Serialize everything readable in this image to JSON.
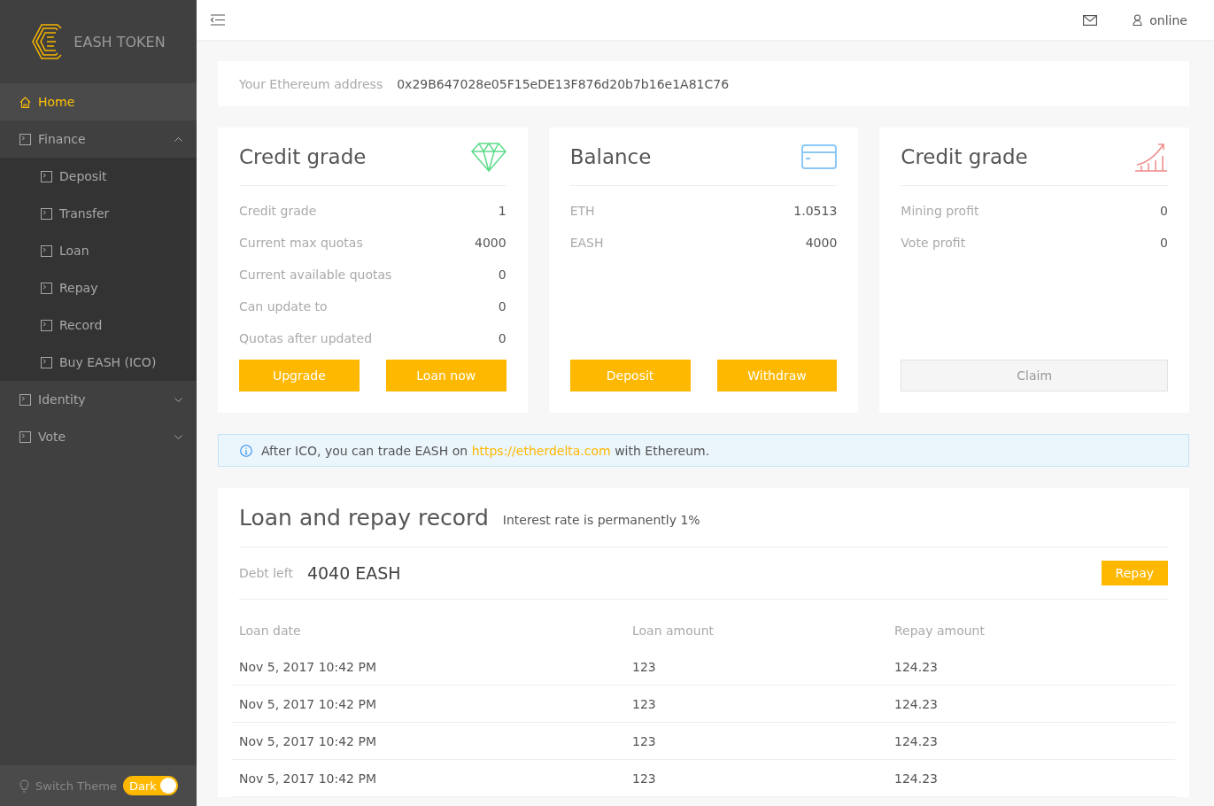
{
  "brand": {
    "name": "EASH TOKEN"
  },
  "sidebar": {
    "items": [
      {
        "label": "Home",
        "kind": "home",
        "selected": true
      },
      {
        "label": "Finance",
        "kind": "page",
        "selected": false,
        "expanded": true,
        "children": [
          {
            "label": "Deposit",
            "selected": false
          },
          {
            "label": "Transfer",
            "selected": false
          },
          {
            "label": "Loan",
            "selected": false
          },
          {
            "label": "Repay",
            "selected": false
          },
          {
            "label": "Record",
            "selected": false
          },
          {
            "label": "Buy EASH (ICO)",
            "selected": false
          }
        ]
      },
      {
        "label": "Identity",
        "kind": "page",
        "selected": false,
        "expanded": false
      },
      {
        "label": "Vote",
        "kind": "page",
        "selected": false,
        "expanded": false
      }
    ]
  },
  "theme_switch": {
    "label": "Switch Theme",
    "value": "Dark",
    "on": true
  },
  "header": {
    "user": "online"
  },
  "address": {
    "label": "Your Ethereum address",
    "value": "0x29B647028e05F15eDE13F876d20b7b16e1A81C76"
  },
  "cards": [
    {
      "title": "Credit grade",
      "kind": "diamond",
      "rows": [
        {
          "label": "Credit grade",
          "value": "1"
        },
        {
          "label": "Current max quotas",
          "value": "4000"
        },
        {
          "label": "Current available quotas",
          "value": "0"
        },
        {
          "label": "Can update to",
          "value": "0"
        },
        {
          "label": "Quotas after updated",
          "value": "0"
        }
      ],
      "buttons": [
        {
          "label": "Upgrade",
          "disabled": false
        },
        {
          "label": "Loan now",
          "disabled": false
        }
      ]
    },
    {
      "title": "Balance",
      "kind": "card",
      "rows": [
        {
          "label": "ETH",
          "value": "1.0513"
        },
        {
          "label": "EASH",
          "value": "4000"
        }
      ],
      "buttons": [
        {
          "label": "Deposit",
          "disabled": false
        },
        {
          "label": "Withdraw",
          "disabled": false
        }
      ]
    },
    {
      "title": "Credit grade",
      "kind": "chart",
      "rows": [
        {
          "label": "Mining profit",
          "value": "0"
        },
        {
          "label": "Vote profit",
          "value": "0"
        }
      ],
      "buttons": [
        {
          "label": "Claim",
          "disabled": true
        }
      ]
    }
  ],
  "notice": {
    "before": "After ICO, you can trade EASH on",
    "link": "https://etherdelta.com",
    "after": "with Ethereum."
  },
  "record": {
    "title": "Loan and repay record",
    "subtitle": "Interest rate is permanently 1%",
    "debt_label": "Debt left",
    "debt_value": "4040 EASH",
    "repay_button": "Repay",
    "columns": [
      "Loan date",
      "Loan amount",
      "Repay amount"
    ],
    "rows": [
      [
        "Nov 5, 2017 10:42 PM",
        "123",
        "124.23"
      ],
      [
        "Nov 5, 2017 10:42 PM",
        "123",
        "124.23"
      ],
      [
        "Nov 5, 2017 10:42 PM",
        "123",
        "124.23"
      ],
      [
        "Nov 5, 2017 10:42 PM",
        "123",
        "124.23"
      ]
    ]
  }
}
